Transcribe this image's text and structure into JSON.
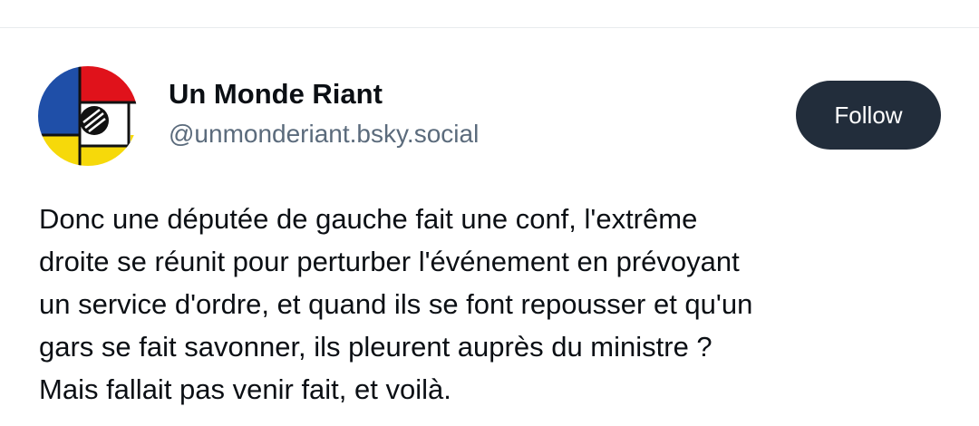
{
  "author": {
    "display_name": "Un Monde Riant",
    "handle": "@unmonderiant.bsky.social",
    "avatar_icon": "flag-collage-avatar-icon"
  },
  "actions": {
    "follow_label": "Follow"
  },
  "post": {
    "lines": [
      "Donc une députée de gauche fait une conf, l'extrême",
      "droite se réunit pour perturber l'événement en prévoyant",
      "un service d'ordre, et quand ils se font repousser et qu'un",
      "gars se fait savonner, ils pleurent auprès du ministre ?",
      "Mais fallait pas venir fait, et voilà."
    ]
  },
  "colors": {
    "follow_bg": "#222d3b",
    "handle": "#5b6b7c",
    "text": "#0b0f14"
  }
}
